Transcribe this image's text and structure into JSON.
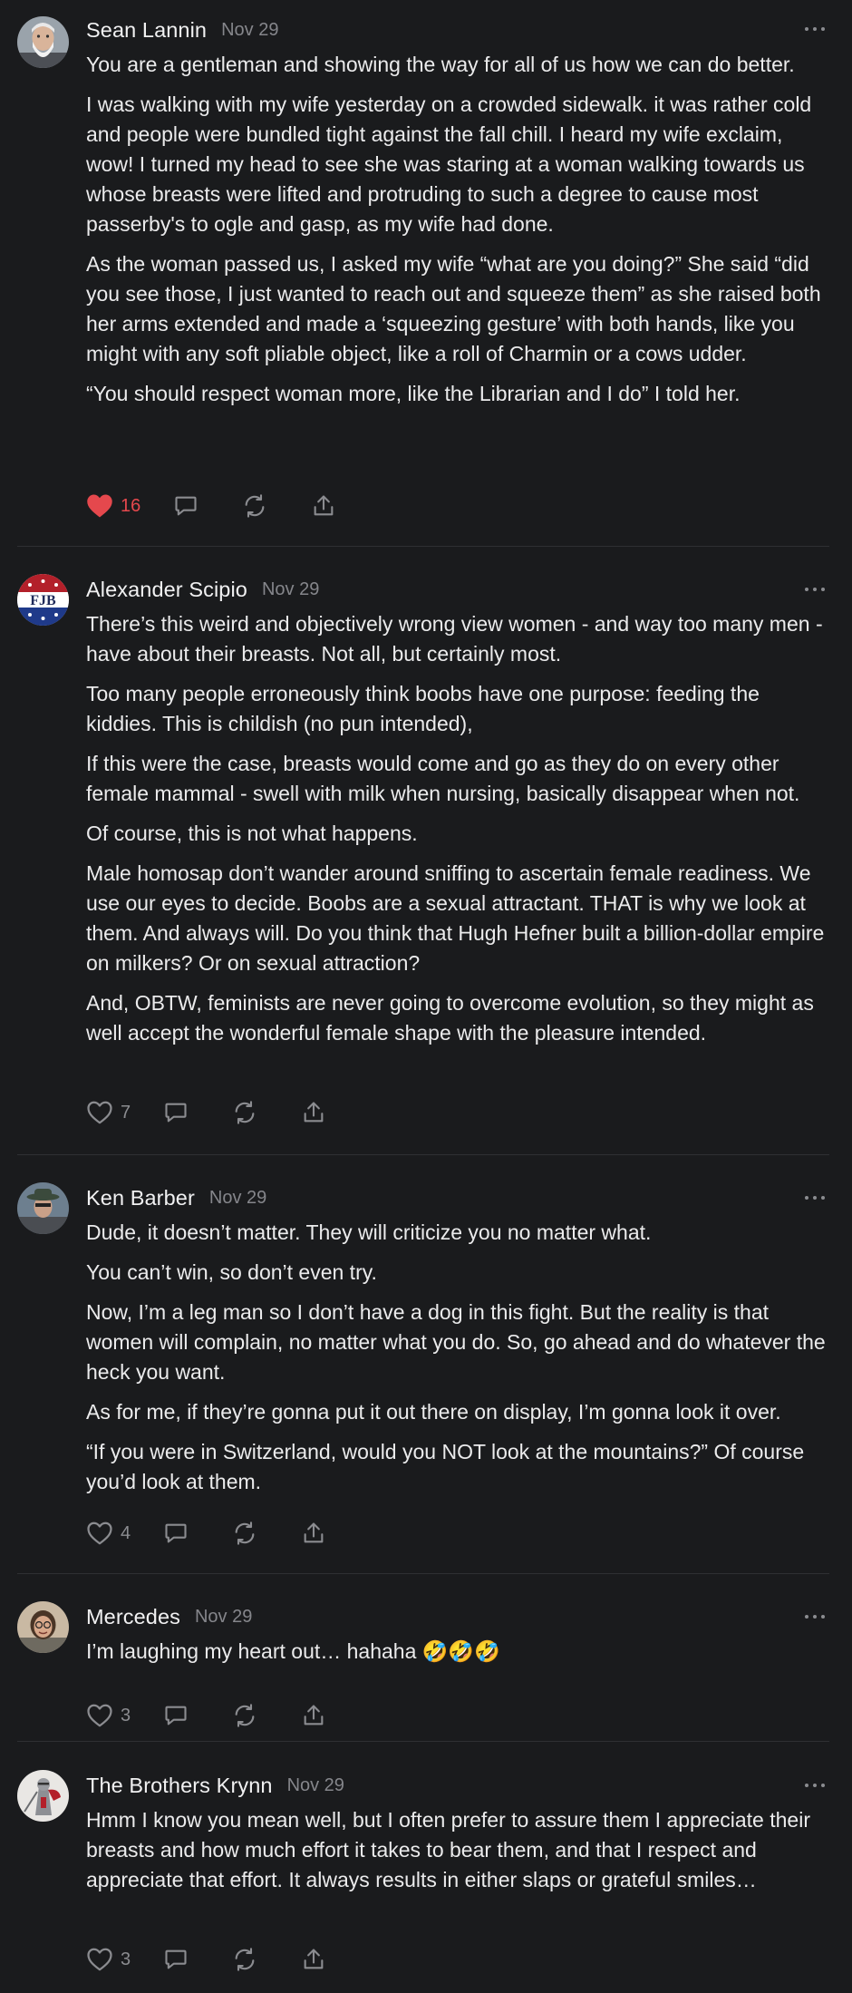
{
  "colors": {
    "background": "#1a1b1d",
    "text": "#ebebec",
    "muted": "#85868b",
    "like_active": "#e5484d",
    "divider": "#2f3033"
  },
  "comments": [
    {
      "author": "Sean Lannin",
      "date": "Nov 29",
      "avatar": "avatar-bearded-man",
      "paragraphs": [
        "You are a gentleman and showing the way for all of us how we can do better.",
        "I was walking with my wife yesterday on a crowded sidewalk. it was rather cold and people were bundled tight against the fall chill. I heard my wife exclaim, wow! I turned my head to see she was staring at a woman walking towards us whose breasts were lifted and protruding to such a degree to cause most passerby's to ogle and gasp, as my wife had done.",
        "As the woman passed us, I asked my wife “what are you doing?” She said “did you see those, I just wanted to reach out and squeeze them” as she raised both her arms extended and made a ‘squeezing gesture’ with both hands, like you might with any soft pliable object, like a roll of Charmin or a cows udder.",
        "“You should respect woman more, like the Librarian and I do” I told her."
      ],
      "likes": "16",
      "liked": true
    },
    {
      "author": "Alexander Scipio",
      "date": "Nov 29",
      "avatar": "avatar-fjb-badge",
      "avatar_text": "FJB",
      "paragraphs": [
        "There’s this weird and objectively wrong view women - and way too many men - have about their breasts. Not all, but certainly most.",
        "Too many people erroneously think boobs have one purpose: feeding the kiddies. This is childish (no pun intended),",
        "If this were the case, breasts would come and go as they do on every other female mammal - swell with milk when nursing, basically disappear when not.",
        "Of course, this is not what happens.",
        "Male homosap don’t wander around sniffing to ascertain female readiness. We use our eyes to decide. Boobs are a sexual attractant. THAT is why we look at them. And always will. Do you think that Hugh Hefner built a billion-dollar empire on milkers? Or on sexual attraction?",
        "And, OBTW, feminists are never going to overcome evolution, so they might as well accept the wonderful female shape with the pleasure intended."
      ],
      "likes": "7",
      "liked": false
    },
    {
      "author": "Ken Barber",
      "date": "Nov 29",
      "avatar": "avatar-man-with-hat",
      "paragraphs": [
        "Dude, it doesn’t matter. They will criticize you no matter what.",
        "You can’t win, so don’t even try.",
        "Now, I’m a leg man so I don’t have a dog in this fight. But the reality is that women will complain, no matter what you do. So, go ahead and do whatever the heck you want.",
        "As for me, if they’re gonna put it out there on display, I’m gonna look it over.",
        "“If you were in Switzerland, would you NOT look at the mountains?” Of course you’d look at them."
      ],
      "likes": "4",
      "liked": false
    },
    {
      "author": "Mercedes",
      "date": "Nov 29",
      "avatar": "avatar-woman-glasses",
      "paragraphs": [
        "I’m laughing my heart out… hahaha 🤣🤣🤣"
      ],
      "likes": "3",
      "liked": false
    },
    {
      "author": "The Brothers Krynn",
      "date": "Nov 29",
      "avatar": "avatar-knight",
      "paragraphs": [
        "Hmm I know you mean well, but I often prefer to assure them I appreciate their breasts and how much effort it takes to bear them, and that I respect and appreciate that effort. It always results in either slaps or grateful smiles…"
      ],
      "likes": "3",
      "liked": false
    }
  ]
}
